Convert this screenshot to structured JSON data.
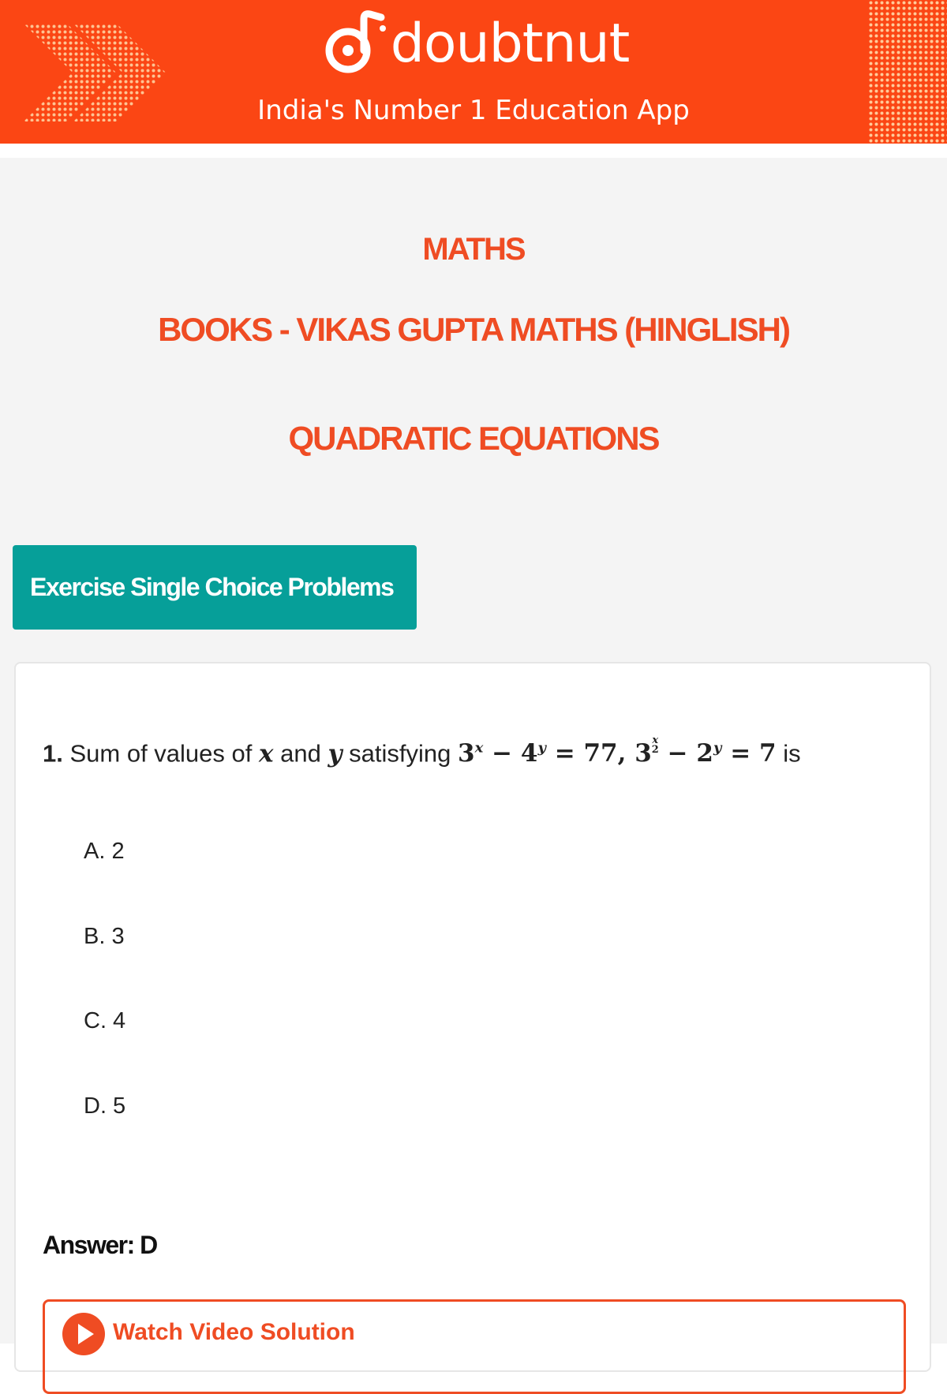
{
  "header": {
    "brand": "doubtnut",
    "tagline": "India's Number 1 Education App",
    "colors": {
      "banner": "#fb4614",
      "accent": "#ef4c23",
      "exercise_button": "#069f99"
    }
  },
  "titles": {
    "subject": "MATHS",
    "book": "BOOKS - VIKAS GUPTA MATHS (HINGLISH)",
    "chapter": "QUADRATIC EQUATIONS"
  },
  "exercise_button": {
    "label": "Exercise Single Choice Problems"
  },
  "question": {
    "number": "1.",
    "text_before": "Sum of values of",
    "var_x": "x",
    "and": "and",
    "var_y": "y",
    "satisfying": "satisfying",
    "trailing": "is"
  },
  "options": [
    {
      "label": "A. 2"
    },
    {
      "label": "B. 3"
    },
    {
      "label": "C. 4"
    },
    {
      "label": "D. 5"
    }
  ],
  "answer": "Answer: D",
  "video": {
    "label": "Watch Video Solution",
    "icon": "play-icon"
  }
}
